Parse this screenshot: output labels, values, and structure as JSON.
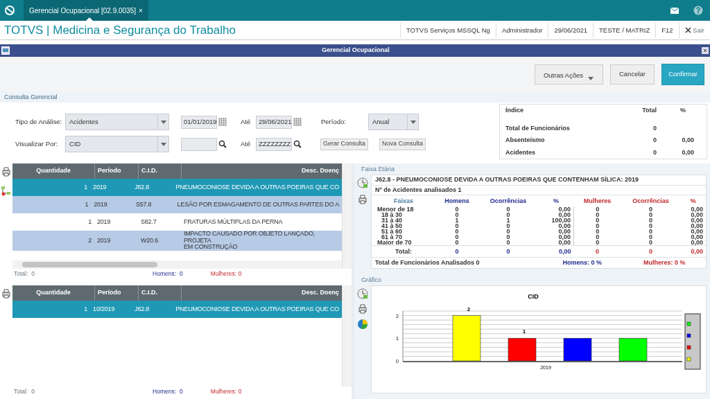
{
  "app_tab": {
    "title": "Gerencial Ocupacional [02.9.0035]",
    "close": "×",
    "selected": true
  },
  "header": {
    "title": "TOTVS | Medicina e Segurança do Trabalho",
    "items": [
      "TOTVS Serviços MSSQL Ng",
      "Administrador",
      "29/06/2021",
      "TESTE / MATRIZ",
      "F12"
    ],
    "exit": "Sair"
  },
  "dialog": {
    "title": "Gerencial Ocupacional"
  },
  "buttons": [
    {
      "label": "Outras Ações",
      "kind": "dropdown"
    },
    {
      "label": "Cancelar",
      "kind": "default"
    },
    {
      "label": "Confirmar",
      "kind": "primary"
    }
  ],
  "section": "Consulta Gerencial",
  "form": {
    "tipo_label": "Tipo de Análise:",
    "tipo_value": "Acidentes",
    "date_from": "01/01/2019",
    "ate_label_1": "Até",
    "date_to": "29/06/2021",
    "periodo_label": "Período:",
    "periodo_value": "Anual",
    "visualizar_label": "Visualizar Por:",
    "visualizar_value": "CID",
    "ate_label_2": "Até",
    "cid_to": "ZZZZZZZZ",
    "generate_button": "Gerar Consulta",
    "new_button": "Nova Consulta"
  },
  "summary": {
    "columns": [
      "Índice",
      "Total",
      "%"
    ],
    "rows": [
      {
        "label": "Total de Funcionários",
        "total": "0"
      },
      {
        "label": "Absenteísmo",
        "total": "0",
        "percent": "0,00"
      },
      {
        "label": "Acidentes",
        "total": "0",
        "percent": "0,00"
      }
    ]
  },
  "grids": [
    {
      "columns": [
        "Quantidade",
        "Período",
        "C.I.D.",
        "Desc. Doenç"
      ],
      "rows": [
        {
          "quantity": "1",
          "period": "2019",
          "cid": "J62.8",
          "description": "PNEUMOCONIOSE DEVIDA A OUTRAS POEIRAS QUE CO",
          "selected": true
        },
        {
          "quantity": "1",
          "period": "2019",
          "cid": "S57.8",
          "description": "LESÃO POR ESMAGAMENTO DE OUTRAS PARTES DO A",
          "selected": false
        },
        {
          "quantity": "1",
          "period": "2019",
          "cid": "S82.7",
          "description": "FRATURAS MÚLTIPLAS DA PERNA",
          "selected": false
        },
        {
          "quantity": "2",
          "period": "2019",
          "cid": "W20.6",
          "description": "IMPACTO CAUSADO POR OBJETO LANÇADO, PROJETA\nEM CONSTRUÇÃO",
          "selected": false
        }
      ],
      "footer": {
        "total_label": "Total:",
        "total": "0",
        "men_label": "Homens:",
        "men": "0",
        "women_label": "Mulheres:",
        "women": "0"
      }
    },
    {
      "columns": [
        "Quantidade",
        "Período",
        "C.I.D.",
        "Desc. Doenç"
      ],
      "rows": [
        {
          "quantity": "1",
          "period": "10/2019",
          "cid": "J62.8",
          "description": "PNEUMOCONIOSE DEVIDA A OUTRAS POEIRAS QUE CO",
          "selected": true
        }
      ],
      "footer": {
        "total_label": "Total:",
        "total": "0",
        "men_label": "Homens:",
        "men": "0",
        "women_label": "Mulheres:",
        "women": "0"
      }
    }
  ],
  "age_panel": {
    "label": "Faixa Etária",
    "title": "J62.8 - PNEUMOCONIOSE DEVIDA A OUTRAS POEIRAS QUE CONTENHAM SÍLICA: 2019",
    "subtitle": "Nº de Acidentes analisados 1",
    "columns": [
      "Faixas",
      "Homens",
      "Ocorrências",
      "%",
      "Mulheres",
      "Ocorrências",
      "%"
    ],
    "rows": [
      [
        "Menor de 18",
        "0",
        "0",
        "0,00",
        "0",
        "0",
        "0,00"
      ],
      [
        "18 à 30",
        "0",
        "0",
        "0,00",
        "0",
        "0",
        "0,00"
      ],
      [
        "31 à 40",
        "1",
        "1",
        "100,00",
        "0",
        "0",
        "0,00"
      ],
      [
        "41 à 50",
        "0",
        "0",
        "0,00",
        "0",
        "0",
        "0,00"
      ],
      [
        "51 à 60",
        "0",
        "0",
        "0,00",
        "0",
        "0",
        "0,00"
      ],
      [
        "61 à 70",
        "0",
        "0",
        "0,00",
        "0",
        "0",
        "0,00"
      ],
      [
        "Maior de 70",
        "0",
        "0",
        "0,00",
        "0",
        "0",
        "0,00"
      ]
    ],
    "total": [
      "Total:",
      "0",
      "0",
      "0,00",
      "0",
      "0",
      "0,00"
    ],
    "analysed": "Total de Funcionários Analisados 0",
    "men": "Homens: 0 %",
    "women": "Mulheres: 0 %"
  },
  "chart_panel": {
    "label": "Gráfico",
    "chart_data": {
      "type": "bar",
      "title": "CID",
      "categories": [
        "2019"
      ],
      "yticks": [
        0,
        1,
        2
      ],
      "series": [
        {
          "color": "#ffff00",
          "values": [
            2
          ]
        },
        {
          "color": "#ff0000",
          "values": [
            1
          ]
        },
        {
          "color": "#0000ff",
          "values": [
            1
          ]
        },
        {
          "color": "#00ff00",
          "values": [
            1
          ]
        }
      ],
      "ylim": [
        0,
        2.2
      ],
      "annotations": [
        {
          "text": "2",
          "y": 2
        },
        {
          "text": "1",
          "y": 1
        }
      ]
    }
  }
}
